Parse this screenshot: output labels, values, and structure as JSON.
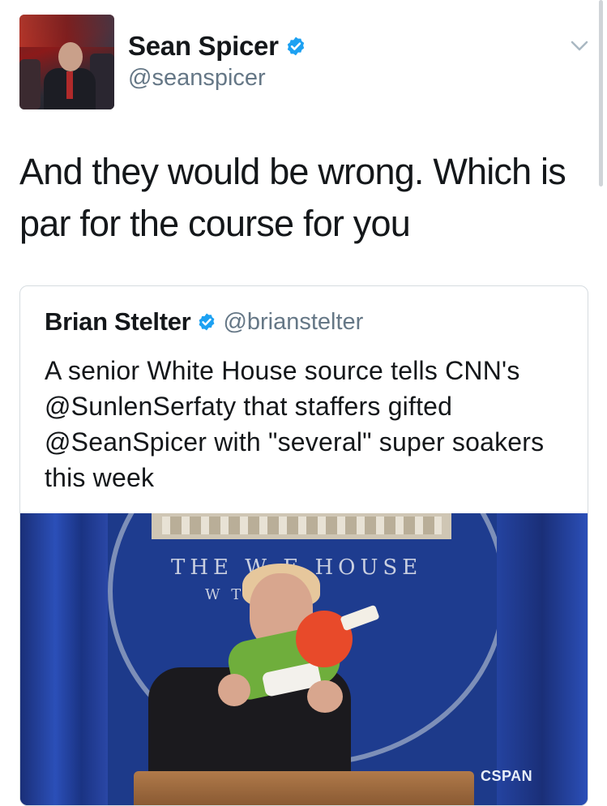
{
  "author": {
    "name": "Sean Spicer",
    "handle": "@seanspicer",
    "verified_icon": "verified-badge-icon"
  },
  "tweet": {
    "text": "And they would be wrong.  Which is par for the course for you"
  },
  "quoted_tweet": {
    "name": "Brian Stelter",
    "handle": "@brianstelter",
    "text": "A senior White House source tells CNN's @SunlenSerfaty that staffers gifted @SeanSpicer with \"several\" super soakers this week",
    "media": {
      "seal_text_line1": "THE W    E HOUSE",
      "seal_text_line2": "W         TON",
      "watermark": "CSPAN"
    }
  },
  "colors": {
    "text": "#14171a",
    "secondary": "#657786",
    "verified": "#1da1f2",
    "border": "#d6dce0"
  }
}
